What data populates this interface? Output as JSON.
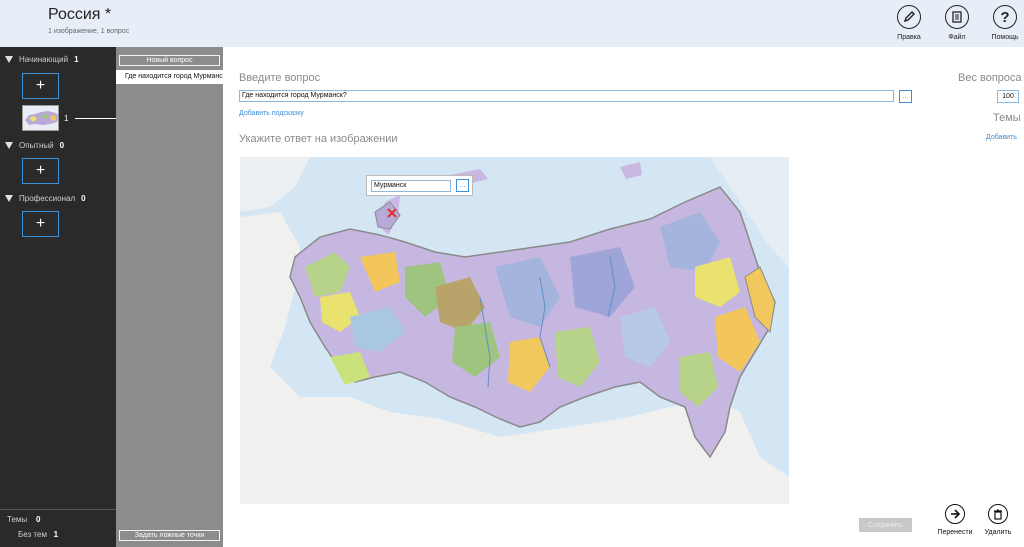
{
  "header": {
    "title": "Россия *",
    "subtitle": "1 изображение, 1 вопрос",
    "buttons": [
      {
        "label": "Правка",
        "icon": "pencil-icon"
      },
      {
        "label": "Файл",
        "icon": "file-icon"
      },
      {
        "label": "Помощь",
        "icon": "help-icon"
      }
    ]
  },
  "sidebar": {
    "levels": [
      {
        "name": "Начинающий",
        "count": "1"
      },
      {
        "name": "Опытный",
        "count": "0"
      },
      {
        "name": "Профессионал",
        "count": "0"
      }
    ],
    "thumbnail_number": "1",
    "footer": {
      "topics_label": "Темы",
      "topics_count": "0",
      "untagged_label": "Без тем",
      "untagged_count": "1"
    }
  },
  "questions": {
    "new_button": "Новый вопрос",
    "items": [
      "Где находится город Мурманск?"
    ],
    "false_points_button": "Задать ложные точки"
  },
  "editor": {
    "question_label": "Введите вопрос",
    "question_value": "Где находится город Мурманск?",
    "add_hint": "Добавить подсказку",
    "answer_label": "Укажите ответ на изображении",
    "answer_value": "Мурманск",
    "weight_label": "Вес вопроса",
    "weight_value": "100",
    "topics_label": "Темы",
    "topics_add": "Добавить"
  },
  "actions": {
    "save": "Сохранить",
    "move": "Перенести",
    "delete": "Удалить"
  },
  "colors": {
    "accent": "#3c8fd9",
    "header_bg": "#e7eef7",
    "sidebar_bg": "#2a2a2a",
    "questions_bg": "#8c8c8c",
    "map_water": "#d4e6f4"
  }
}
